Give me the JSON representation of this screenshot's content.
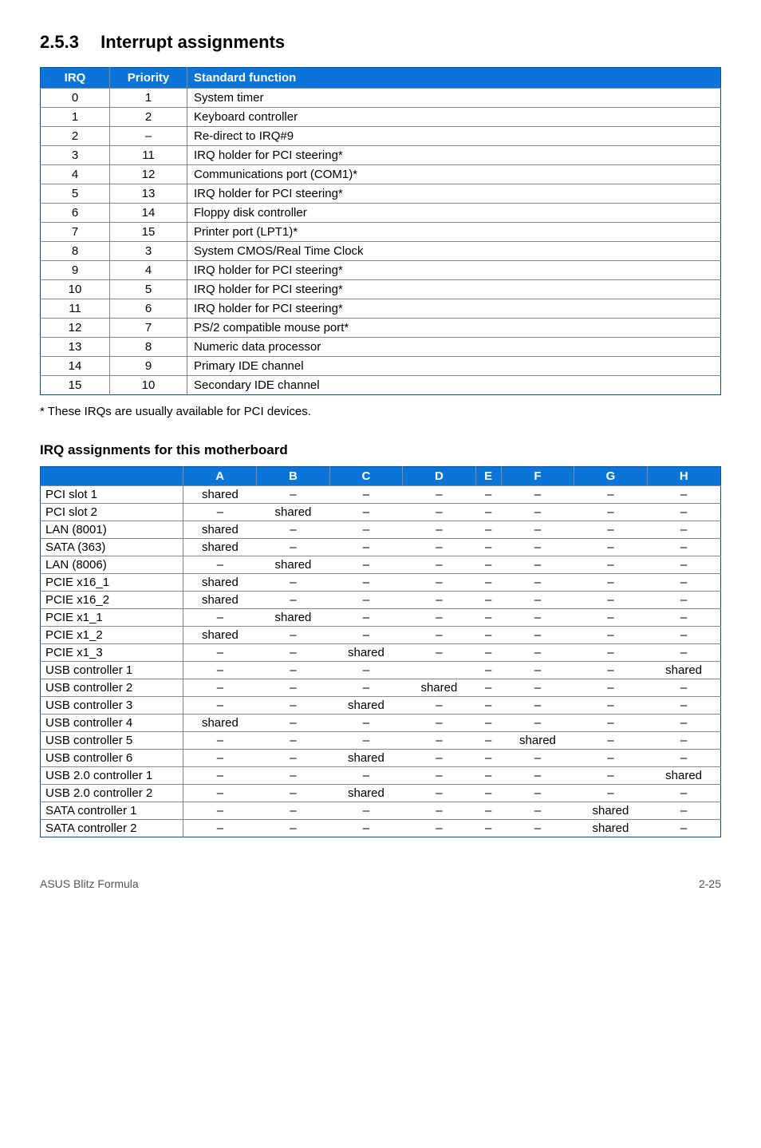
{
  "section_number": "2.5.3",
  "section_title": "Interrupt assignments",
  "irq_table": {
    "headers": {
      "irq": "IRQ",
      "priority": "Priority",
      "func": "Standard function"
    },
    "rows": [
      {
        "irq": "0",
        "priority": "1",
        "func": "System timer"
      },
      {
        "irq": "1",
        "priority": "2",
        "func": "Keyboard controller"
      },
      {
        "irq": "2",
        "priority": "–",
        "func": "Re-direct to IRQ#9"
      },
      {
        "irq": "3",
        "priority": "11",
        "func": "IRQ holder for PCI steering*"
      },
      {
        "irq": "4",
        "priority": "12",
        "func": "Communications port (COM1)*"
      },
      {
        "irq": "5",
        "priority": "13",
        "func": "IRQ holder for PCI steering*"
      },
      {
        "irq": "6",
        "priority": "14",
        "func": "Floppy disk controller"
      },
      {
        "irq": "7",
        "priority": "15",
        "func": "Printer port (LPT1)*"
      },
      {
        "irq": "8",
        "priority": "3",
        "func": "System CMOS/Real Time Clock"
      },
      {
        "irq": "9",
        "priority": "4",
        "func": "IRQ holder for PCI steering*"
      },
      {
        "irq": "10",
        "priority": "5",
        "func": "IRQ holder for PCI steering*"
      },
      {
        "irq": "11",
        "priority": "6",
        "func": "IRQ holder for PCI steering*"
      },
      {
        "irq": "12",
        "priority": "7",
        "func": "PS/2 compatible mouse port*"
      },
      {
        "irq": "13",
        "priority": "8",
        "func": "Numeric data processor"
      },
      {
        "irq": "14",
        "priority": "9",
        "func": "Primary IDE channel"
      },
      {
        "irq": "15",
        "priority": "10",
        "func": "Secondary IDE channel"
      }
    ]
  },
  "note_text": "* These IRQs are usually available for PCI devices.",
  "subhead": "IRQ assignments for this motherboard",
  "assign_table": {
    "cols": [
      "A",
      "B",
      "C",
      "D",
      "E",
      "F",
      "G",
      "H"
    ],
    "rows": [
      {
        "label": "PCI slot 1",
        "cells": [
          "shared",
          "–",
          "–",
          "–",
          "–",
          "–",
          "–",
          "–"
        ]
      },
      {
        "label": "PCI slot 2",
        "cells": [
          "–",
          "shared",
          "–",
          "–",
          "–",
          "–",
          "–",
          "–"
        ]
      },
      {
        "label": "LAN (8001)",
        "cells": [
          "shared",
          "–",
          "–",
          "–",
          "–",
          "–",
          "–",
          "–"
        ]
      },
      {
        "label": "SATA (363)",
        "cells": [
          "shared",
          "–",
          "–",
          "–",
          "–",
          "–",
          "–",
          "–"
        ]
      },
      {
        "label": "LAN (8006)",
        "cells": [
          "–",
          "shared",
          "–",
          "–",
          "–",
          "–",
          "–",
          "–"
        ]
      },
      {
        "label": "PCIE x16_1",
        "cells": [
          "shared",
          "–",
          "–",
          "–",
          "–",
          "–",
          "–",
          "–"
        ]
      },
      {
        "label": "PCIE x16_2",
        "cells": [
          "shared",
          "–",
          "–",
          "–",
          "–",
          "–",
          "–",
          "–"
        ]
      },
      {
        "label": "PCIE x1_1",
        "cells": [
          "–",
          "shared",
          "–",
          "–",
          "–",
          "–",
          "–",
          "–"
        ]
      },
      {
        "label": "PCIE x1_2",
        "cells": [
          "shared",
          "–",
          "–",
          "–",
          "–",
          "–",
          "–",
          "–"
        ]
      },
      {
        "label": "PCIE x1_3",
        "cells": [
          "–",
          "–",
          "shared",
          "–",
          "–",
          "–",
          "–",
          "–"
        ]
      },
      {
        "label": "USB controller 1",
        "cells": [
          "–",
          "–",
          "–",
          "",
          "–",
          "–",
          "–",
          "shared"
        ]
      },
      {
        "label": "USB controller 2",
        "cells": [
          "–",
          "–",
          "–",
          "shared",
          "–",
          "–",
          "–",
          "–"
        ]
      },
      {
        "label": "USB controller 3",
        "cells": [
          "–",
          "–",
          "shared",
          "–",
          "–",
          "–",
          "–",
          "–"
        ]
      },
      {
        "label": "USB controller 4",
        "cells": [
          "shared",
          "–",
          "–",
          "–",
          "–",
          "–",
          "–",
          "–"
        ]
      },
      {
        "label": "USB controller 5",
        "cells": [
          "–",
          "–",
          "–",
          "–",
          "–",
          "shared",
          "–",
          "–"
        ]
      },
      {
        "label": "USB controller 6",
        "cells": [
          "–",
          "–",
          "shared",
          "–",
          "–",
          "–",
          "–",
          "–"
        ]
      },
      {
        "label": "USB 2.0 controller 1",
        "cells": [
          "–",
          "–",
          "–",
          "–",
          "–",
          "–",
          "–",
          "shared"
        ]
      },
      {
        "label": "USB 2.0 controller 2",
        "cells": [
          "–",
          "–",
          "shared",
          "–",
          "–",
          "–",
          "–",
          "–"
        ]
      },
      {
        "label": "SATA controller 1",
        "cells": [
          "–",
          "–",
          "–",
          "–",
          "–",
          "–",
          "shared",
          "–"
        ]
      },
      {
        "label": "SATA controller 2",
        "cells": [
          "–",
          "–",
          "–",
          "–",
          "–",
          "–",
          "shared",
          "–"
        ]
      }
    ]
  },
  "footer_left": "ASUS Blitz Formula",
  "footer_right": "2-25"
}
